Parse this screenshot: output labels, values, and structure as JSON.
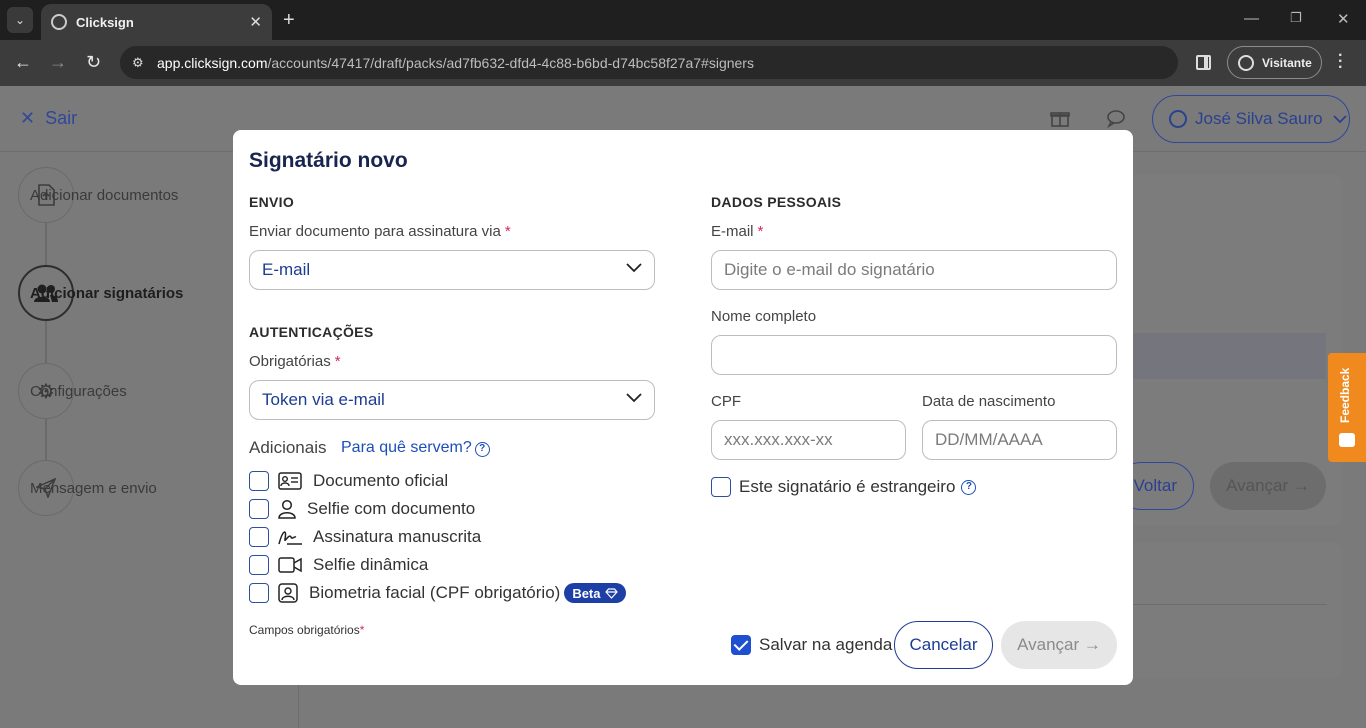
{
  "browser": {
    "tab_title": "Clicksign",
    "url_host": "app.clicksign.com",
    "url_path": "/accounts/47417/draft/packs/ad7fb632-dfd4-4c88-b6bd-d74bc58f27a7#signers",
    "profile_label": "Visitante"
  },
  "header": {
    "exit_label": "Sair",
    "user_name": "José Silva Sauro"
  },
  "sidebar": {
    "steps": [
      {
        "label": "Adicionar documentos",
        "icon": "upload-doc-icon"
      },
      {
        "label": "Adicionar signatários",
        "icon": "users-icon"
      },
      {
        "label": "Configurações",
        "icon": "gear-icon"
      },
      {
        "label": "Mensagem e envio",
        "icon": "paper-plane-icon"
      }
    ]
  },
  "background": {
    "back_label": "Voltar",
    "next_label": "Avançar"
  },
  "feedback_label": "Feedback",
  "modal": {
    "title": "Signatário novo",
    "envio": {
      "section": "ENVIO",
      "label": "Enviar documento para assinatura via",
      "value": "E-mail"
    },
    "auth": {
      "section": "AUTENTICAÇÕES",
      "required_label": "Obrigatórias",
      "required_value": "Token via e-mail",
      "additional_label": "Adicionais",
      "help_link": "Para quê servem?",
      "options": [
        {
          "label": "Documento oficial",
          "icon": "id-card-icon"
        },
        {
          "label": "Selfie com documento",
          "icon": "person-icon"
        },
        {
          "label": "Assinatura manuscrita",
          "icon": "signature-icon"
        },
        {
          "label": "Selfie dinâmica",
          "icon": "video-camera-icon"
        },
        {
          "label": "Biometria facial (CPF obrigatório)",
          "icon": "face-id-icon"
        }
      ],
      "beta_badge": "Beta"
    },
    "personal": {
      "section": "DADOS PESSOAIS",
      "email_label": "E-mail",
      "email_placeholder": "Digite o e-mail do signatário",
      "name_label": "Nome completo",
      "cpf_label": "CPF",
      "cpf_placeholder": "xxx.xxx.xxx-xx",
      "birth_label": "Data de nascimento",
      "birth_placeholder": "DD/MM/AAAA",
      "foreigner_label": "Este signatário é estrangeiro"
    },
    "required_note": "Campos obrigatórios",
    "required_mark": "*",
    "save_contacts_label": "Salvar na agenda",
    "cancel_label": "Cancelar",
    "next_label": "Avançar",
    "accent_color": "#1d3c93"
  }
}
